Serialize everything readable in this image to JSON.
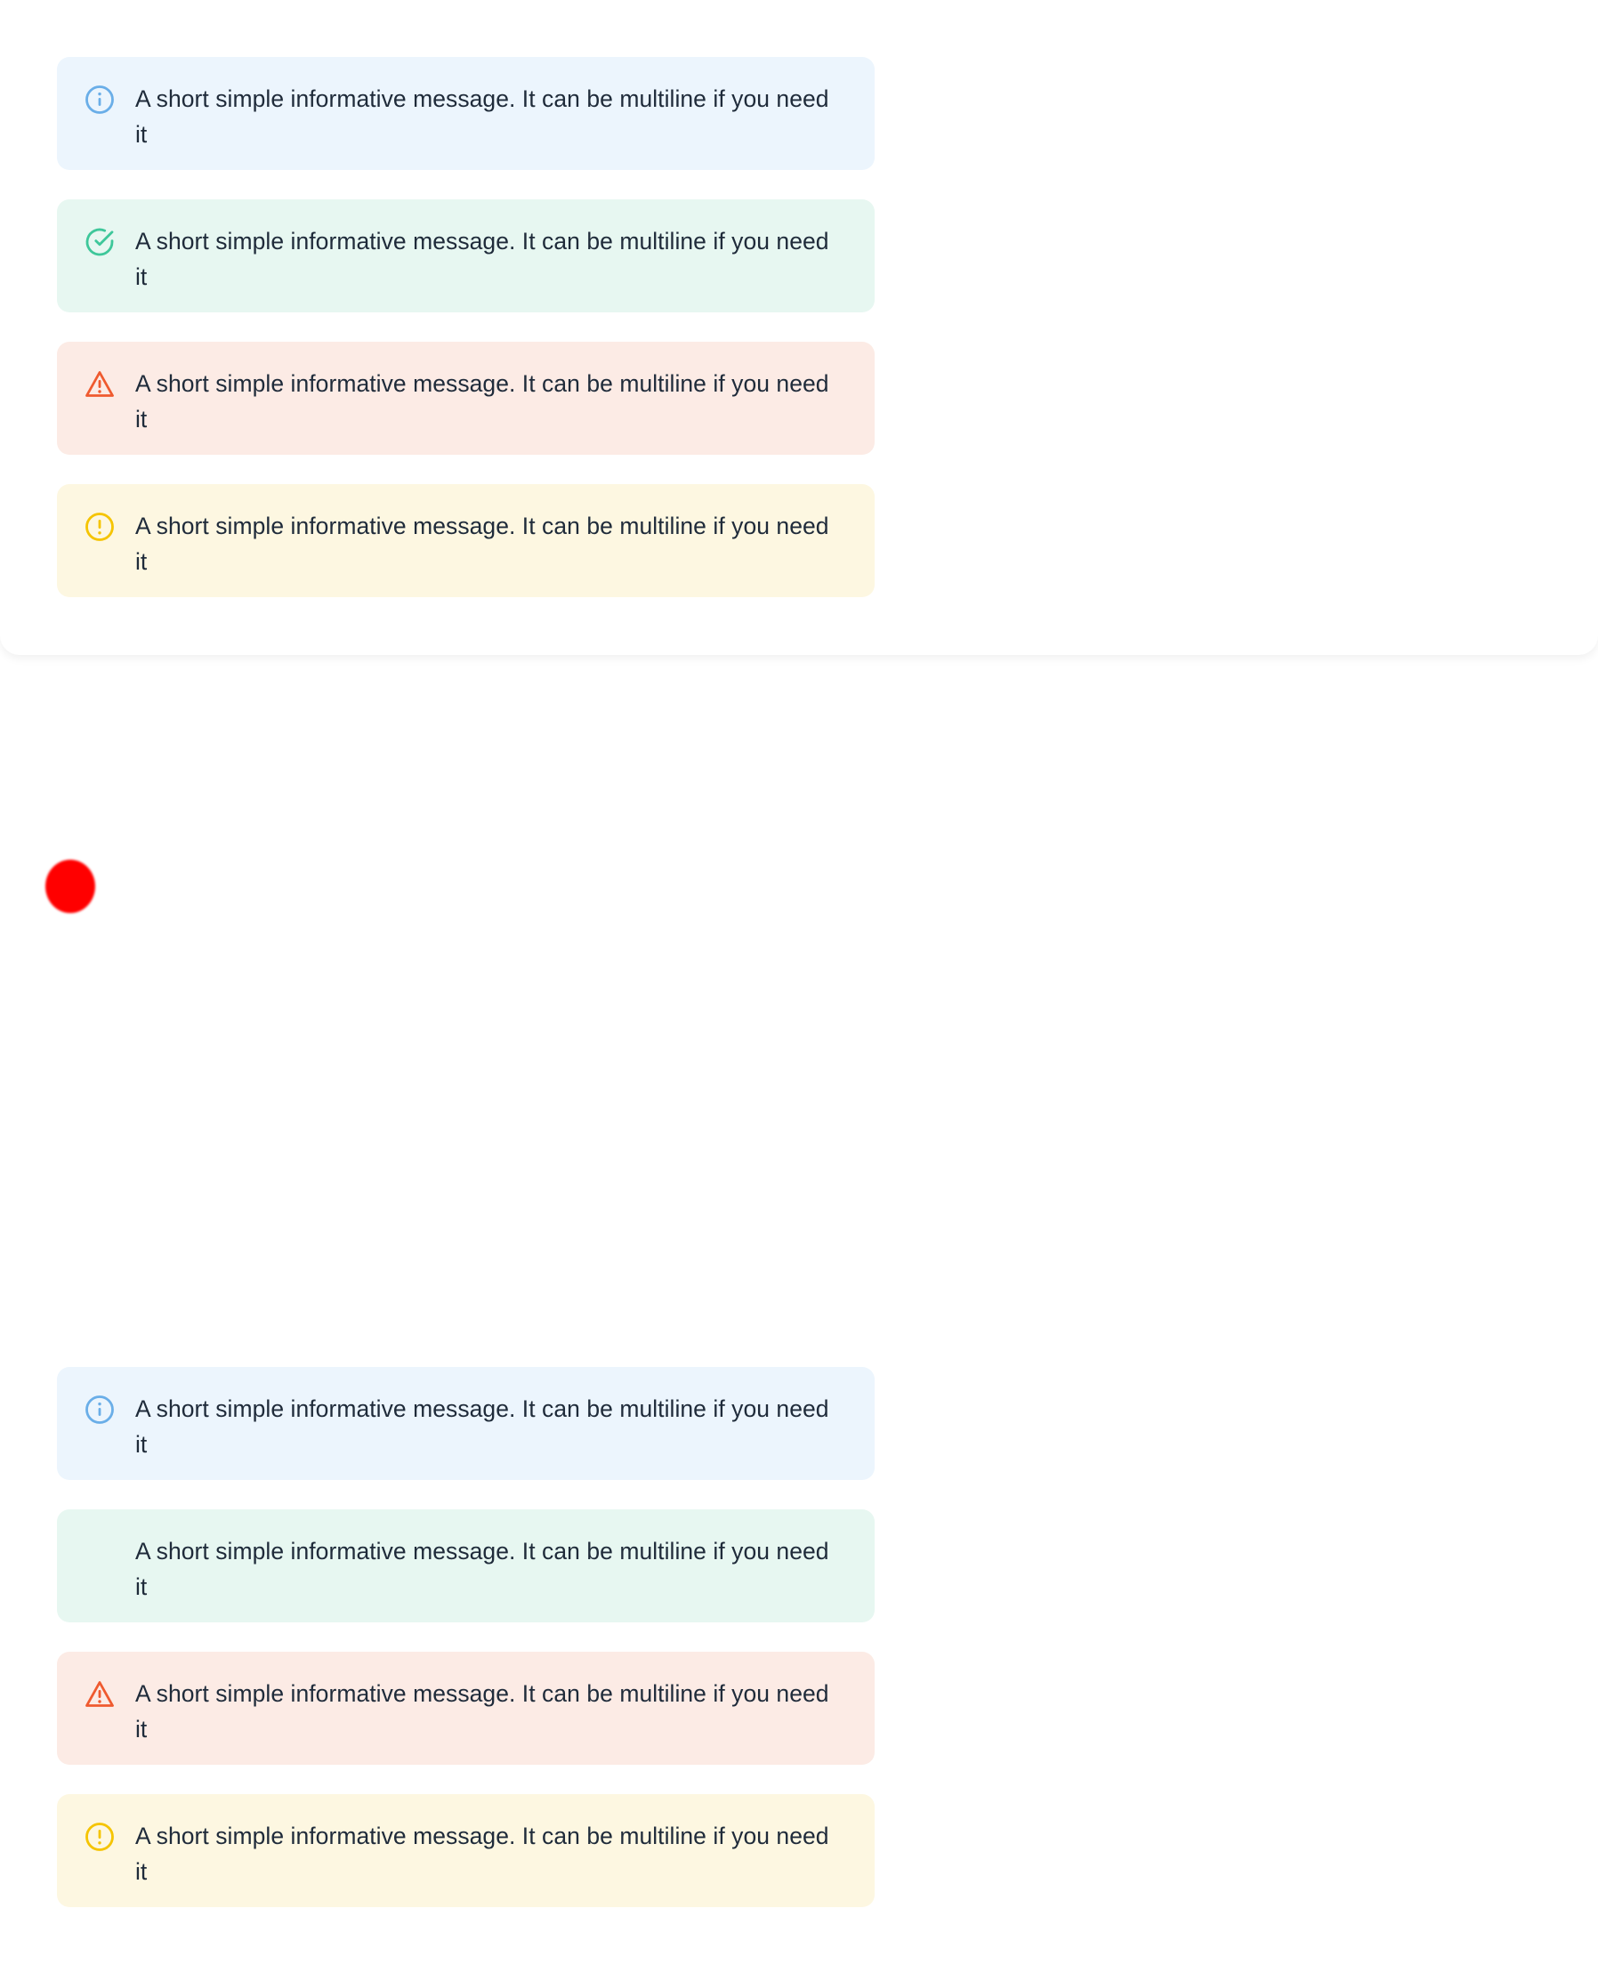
{
  "colors": {
    "info": "#6aaee8",
    "success": "#3ec79a",
    "error": "#ef5a2f",
    "warning": "#f5c400",
    "text": "#1f2b3a"
  },
  "top_alerts": [
    {
      "type": "info",
      "icon": "info-icon",
      "message": "A short simple informative message. It can be multiline if you need it"
    },
    {
      "type": "success",
      "icon": "check-circle-icon",
      "message": "A short simple informative message. It can be multiline if you need it"
    },
    {
      "type": "error",
      "icon": "warning-triangle-icon",
      "message": "A short simple informative message. It can be multiline if you need it"
    },
    {
      "type": "warning",
      "icon": "exclamation-circle-icon",
      "message": "A short simple informative message. It can be multiline if you need it"
    }
  ],
  "bottom_alerts": [
    {
      "type": "info",
      "icon": "info-icon",
      "message": "A short simple informative message. It can be multiline if you need it"
    },
    {
      "type": "success",
      "icon": "",
      "message": "A short simple informative message. It can be multiline if you need it"
    },
    {
      "type": "error",
      "icon": "warning-triangle-icon",
      "message": "A short simple informative message. It can be multiline if you need it"
    },
    {
      "type": "warning",
      "icon": "exclamation-circle-icon",
      "message": "A short simple informative message. It can be multiline if you need it"
    }
  ]
}
